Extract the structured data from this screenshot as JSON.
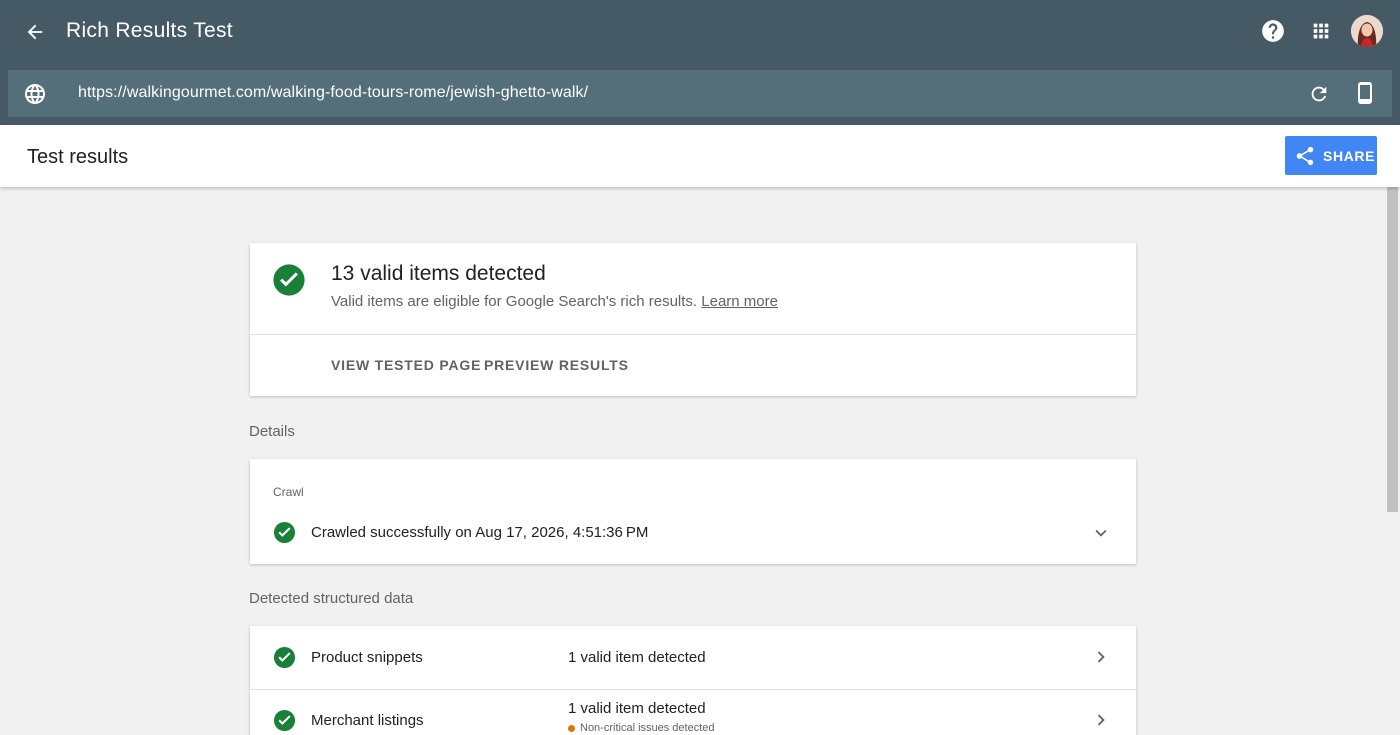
{
  "app": {
    "title": "Rich Results Test",
    "back_icon": "arrow-back-icon",
    "help_icon": "help-icon",
    "apps_icon": "apps-grid-icon",
    "avatar_icon": "user-avatar"
  },
  "urlbar": {
    "globe_icon": "globe-icon",
    "url": "https://walkingourmet.com/walking-food-tours-rome/jewish-ghetto-walk/",
    "refresh_icon": "refresh-icon",
    "device_icon": "smartphone-icon"
  },
  "subheader": {
    "title": "Test results",
    "share_label": "SHARE",
    "share_icon": "share-icon"
  },
  "summary": {
    "title": "13 valid items detected",
    "subtitle": "Valid items are eligible for Google Search's rich results.",
    "learn_more": "Learn more",
    "view_tested_page": "VIEW TESTED PAGE",
    "preview_results": "PREVIEW RESULTS"
  },
  "details": {
    "label": "Details",
    "crawl_label": "Crawl",
    "crawl_status": "Crawled successfully on Aug 17, 2026, 4:51:36 PM"
  },
  "structured": {
    "label": "Detected structured data",
    "rows": [
      {
        "name": "Product snippets",
        "status": "1 valid item detected"
      },
      {
        "name": "Merchant listings",
        "status": "1 valid item detected",
        "warning": "Non-critical issues detected"
      }
    ]
  },
  "colors": {
    "header_bg": "#455a64",
    "urlbar_bg": "#546e7a",
    "success_green": "#188038",
    "share_blue": "#4285f4",
    "warning_orange": "#e37400"
  }
}
